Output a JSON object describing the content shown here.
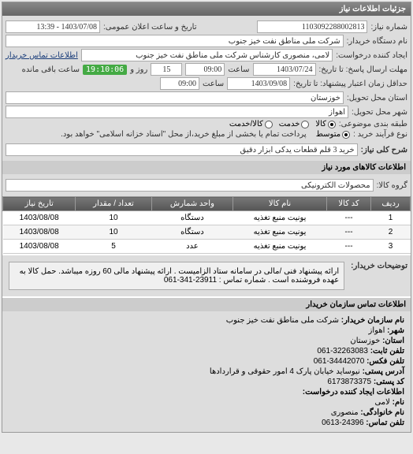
{
  "panel_title": "جزئیات اطلاعات نیاز",
  "request_number_label": "شماره نیاز:",
  "request_number": "1103092288002813",
  "announce_datetime_label": "تاریخ و ساعت اعلان عمومی:",
  "announce_datetime": "1403/07/08 - 13:39",
  "buyer_org_label": "نام دستگاه خریدار:",
  "buyer_org": "شرکت ملی مناطق نفت خیز جنوب",
  "request_creator_label": "ایجاد کننده درخواست:",
  "request_creator": "لامی، منصوری کارشناس شرکت ملی مناطق نفت خیز جنوب",
  "buyer_contact_link": "اطلاعات تماس خریدار",
  "deadline_label": "مهلت ارسال پاسخ: تا تاریخ:",
  "deadline_date": "1403/07/24",
  "time_label": "ساعت",
  "deadline_time": "09:00",
  "remaining_days": "15",
  "days_and_label": "روز و",
  "remaining_time": "19:10:06",
  "remaining_suffix": "ساعت باقی مانده",
  "validity_label": "حداقل زمان اعتبار پیشنهاد: تا تاریخ:",
  "validity_date": "1403/09/08",
  "validity_time": "09:00",
  "delivery_province_label": "استان محل تحویل:",
  "delivery_province": "خوزستان",
  "delivery_city_label": "شهر محل تحویل:",
  "delivery_city": "اهواز",
  "package_type_label": "طبقه بندی موضوعی:",
  "package_options": [
    {
      "label": "کالا",
      "checked": true
    },
    {
      "label": "خدمت",
      "checked": false
    },
    {
      "label": "کالا/خدمت",
      "checked": false
    }
  ],
  "purchase_type_label": "نوع فرآیند خرید :",
  "purchase_options": [
    {
      "label": "متوسط",
      "checked": true
    }
  ],
  "purchase_note": "پرداخت تمام یا بخشی از مبلغ خرید،از محل \"اسناد خزانه اسلامی\" خواهد بود.",
  "need_title_label": "شرح کلی نیاز:",
  "need_title": "خرید 3 قلم قطعات یدکی ابزار دقیق",
  "goods_section_title": "اطلاعات کالاهای مورد نیاز",
  "goods_group_label": "گروه کالا:",
  "goods_group": "محصولات الکترونیکی",
  "table_headers": {
    "row": "ردیف",
    "code": "کد کالا",
    "name": "نام کالا",
    "unit": "واحد شمارش",
    "qty": "تعداد / مقدار",
    "date": "تاریخ نیاز"
  },
  "table_rows": [
    {
      "row": "1",
      "code": "---",
      "name": "یونیت منبع تغذیه",
      "unit": "دستگاه",
      "qty": "10",
      "date": "1403/08/08"
    },
    {
      "row": "2",
      "code": "---",
      "name": "یونیت منبع تغذیه",
      "unit": "دستگاه",
      "qty": "10",
      "date": "1403/08/08"
    },
    {
      "row": "3",
      "code": "---",
      "name": "یونیت منبع تغذیه",
      "unit": "عدد",
      "qty": "5",
      "date": "1403/08/08"
    }
  ],
  "buyer_desc_label": "توضیحات خریدار:",
  "buyer_desc": "ارائه پیشنهاد فنی /مالی در سامانه ستاد الزامیست . ارائه پیشنهاد مالی 60 روزه میباشد. حمل کالا به عهده فروشنده است . شماره تماس : 23911-341-061",
  "contact_section_title": "اطلاعات تماس سازمان خریدار",
  "contact": {
    "org_label": "نام سازمان خریدار:",
    "org": "شرکت ملی مناطق نفت خیز جنوب",
    "city_label": "شهر:",
    "city": "اهواز",
    "province_label": "استان:",
    "province": "خوزستان",
    "phone_label": "تلفن ثابت:",
    "phone": "32263083-061",
    "fax_label": "تلفن فکس:",
    "fax": "34442070-061",
    "address_label": "آدرس پستی:",
    "address": "نیوساید خیابان پارک 4 امور حقوقی و قراردادها",
    "postal_label": "کد پستی:",
    "postal": "6173873375",
    "creator_section": "اطلاعات ایجاد کننده درخواست:",
    "name_label": "نام:",
    "name": "لامی",
    "family_label": "نام خانوادگی:",
    "family": "منصوری",
    "creator_phone_label": "تلفن تماس:",
    "creator_phone": "24396-0613"
  }
}
